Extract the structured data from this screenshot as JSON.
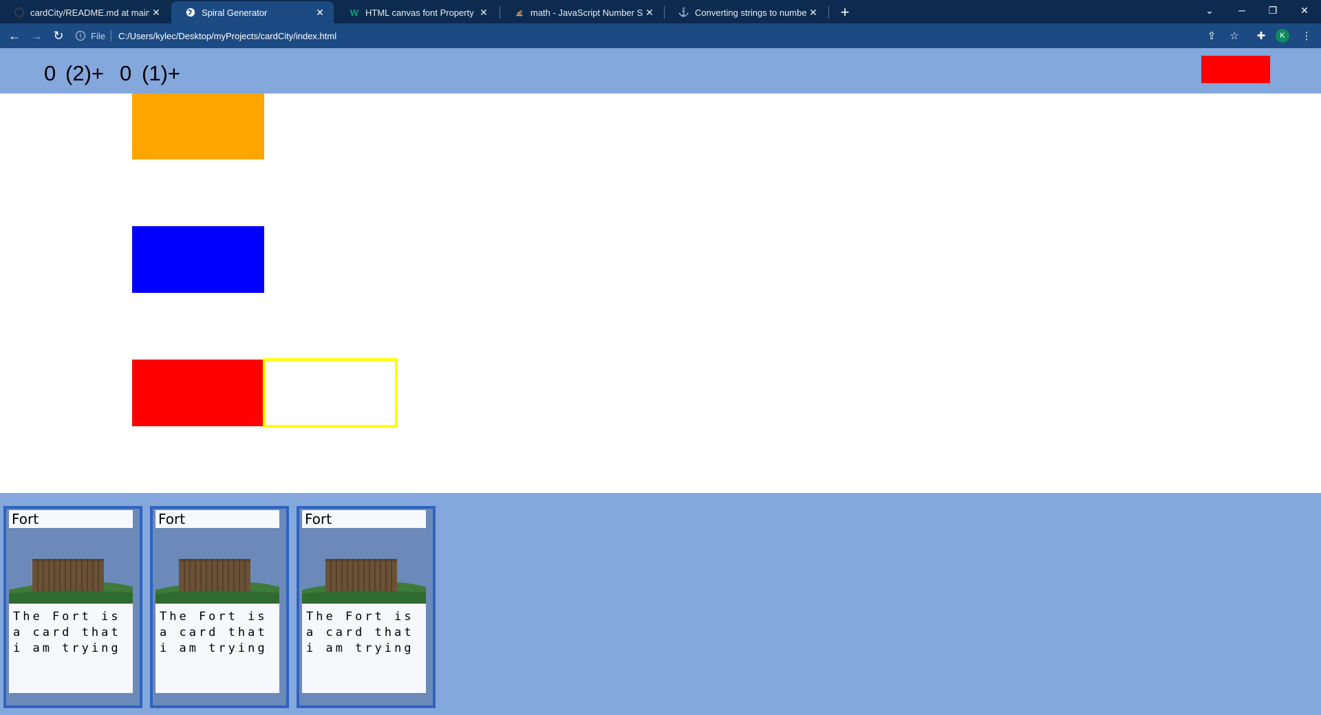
{
  "browser": {
    "tabs": [
      {
        "title": "cardCity/README.md at main · K",
        "icon": "github-icon"
      },
      {
        "title": "Spiral Generator",
        "icon": "globe-icon",
        "active": true
      },
      {
        "title": "HTML canvas font Property",
        "icon": "w3schools-icon"
      },
      {
        "title": "math - JavaScript Number Split in",
        "icon": "stackoverflow-icon"
      },
      {
        "title": "Converting strings to numbers w",
        "icon": "anchor-icon"
      }
    ],
    "address_scheme": "File",
    "address": "C:/Users/kylec/Desktop/myProjects/cardCity/index.html",
    "profile_initial": "K"
  },
  "game": {
    "resources": [
      {
        "value": "0",
        "rate": "(2)+"
      },
      {
        "value": "0",
        "rate": "(1)+"
      }
    ],
    "colors": {
      "top_bar": "#84a7dc",
      "end_turn": "#ff0000",
      "slot_orange": "#ffa500",
      "slot_blue": "#0000ff",
      "slot_red": "#ff0000",
      "slot_highlight": "#ffff00"
    },
    "hand": [
      {
        "title": "Fort",
        "text": "The Fort is a card that i am trying"
      },
      {
        "title": "Fort",
        "text": "The Fort is a card that i am trying"
      },
      {
        "title": "Fort",
        "text": "The Fort is a card that i am trying"
      }
    ]
  }
}
